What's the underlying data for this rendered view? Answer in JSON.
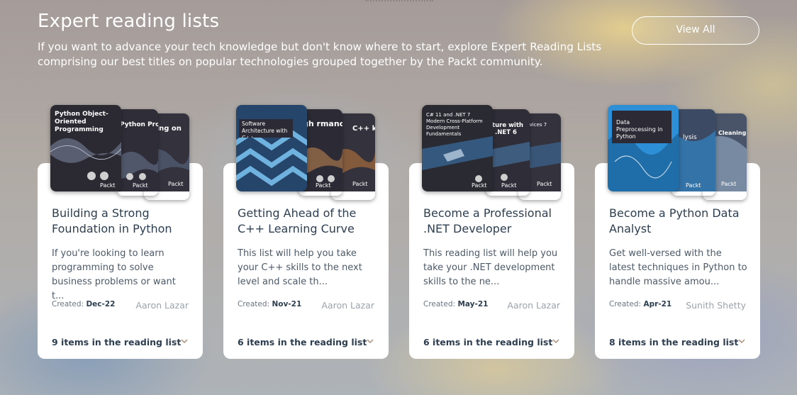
{
  "header": {
    "title": "Expert reading lists",
    "description": "If you want to advance your tech knowledge but don't know where to start, explore Expert Reading Lists comprising our best titles on popular technologies grouped together by the Packt community.",
    "view_all_label": "View All"
  },
  "created_prefix": "Created:",
  "cards": [
    {
      "title": "Building a Strong Foundation in Python",
      "description": "If you're looking to learn programming to solve business problems or want t...",
      "created": "Dec-22",
      "author": "Aaron Lazar",
      "count": "9 items in the reading list",
      "covers": [
        {
          "text": "Python Object-Oriented Programming",
          "brand": "Packt",
          "color": "#2b2a33"
        },
        {
          "text": "Python Programming",
          "brand": "Packt",
          "color": "#2f2e38"
        },
        {
          "text": "ering on",
          "brand": "Packt",
          "color": "#34333d"
        }
      ]
    },
    {
      "title": "Getting Ahead of the C++ Learning Curve",
      "description": "This list will help you take your C++ skills to the next level and scale th...",
      "created": "Nov-21",
      "author": "Aaron Lazar",
      "count": "6 items in the reading list",
      "covers": [
        {
          "text": "Software Architecture with C++",
          "brand": "Packt",
          "color": "#25456a"
        },
        {
          "text": "gh rmance",
          "brand": "Packt",
          "color": "#2c2b35"
        },
        {
          "text": "C++ k",
          "brand": "Packt",
          "color": "#34333d"
        }
      ]
    },
    {
      "title": "Become a Professional .NET Developer",
      "description": "This reading list will help you take your .NET development skills to the ne...",
      "created": "May-21",
      "author": "Aaron Lazar",
      "count": "6 items in the reading list",
      "covers": [
        {
          "text": "C# 11 and .NET 7 Modern Cross-Platform Development Fundamentals",
          "brand": "Packt",
          "color": "#2a2a33"
        },
        {
          "text": "cture with d .NET 6",
          "brand": "Packt",
          "color": "#2f2e38"
        },
        {
          "text": "Services 7",
          "brand": "Packt",
          "color": "#34333d"
        }
      ]
    },
    {
      "title": "Become a Python Data Analyst",
      "description": "Get well-versed with the latest techniques in Python to handle massive amou...",
      "created": "Apr-21",
      "author": "Sunith Shetty",
      "count": "8 items in the reading list",
      "covers": [
        {
          "text": "Data Preprocessing in Python",
          "brand": "Packt",
          "color": "#2d8fd6"
        },
        {
          "text": "lysis",
          "brand": "Packt",
          "color": "#3d4a63"
        },
        {
          "text": "Cleaning",
          "brand": "Packt",
          "color": "#4a5468"
        }
      ]
    }
  ]
}
